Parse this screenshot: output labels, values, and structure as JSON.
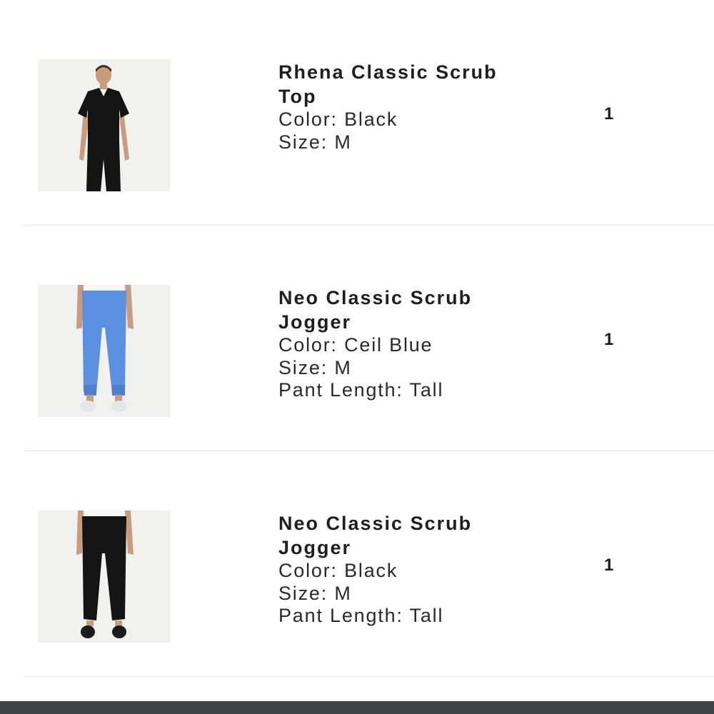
{
  "cart": {
    "items": [
      {
        "name": "Rhena Classic Scrub Top",
        "color": "Color: Black",
        "size": "Size: M",
        "length": "",
        "quantity": "1",
        "image_icon": "scrub-top-black-photo",
        "garment_color": "#141414"
      },
      {
        "name": "Neo Classic Scrub Jogger",
        "color": "Color: Ceil Blue",
        "size": "Size: M",
        "length": "Pant Length: Tall",
        "quantity": "1",
        "image_icon": "jogger-ceil-blue-photo",
        "garment_color": "#5b8fe0"
      },
      {
        "name": "Neo Classic Scrub Jogger",
        "color": "Color: Black",
        "size": "Size: M",
        "length": "Pant Length: Tall",
        "quantity": "1",
        "image_icon": "jogger-black-photo",
        "garment_color": "#141414"
      }
    ]
  }
}
